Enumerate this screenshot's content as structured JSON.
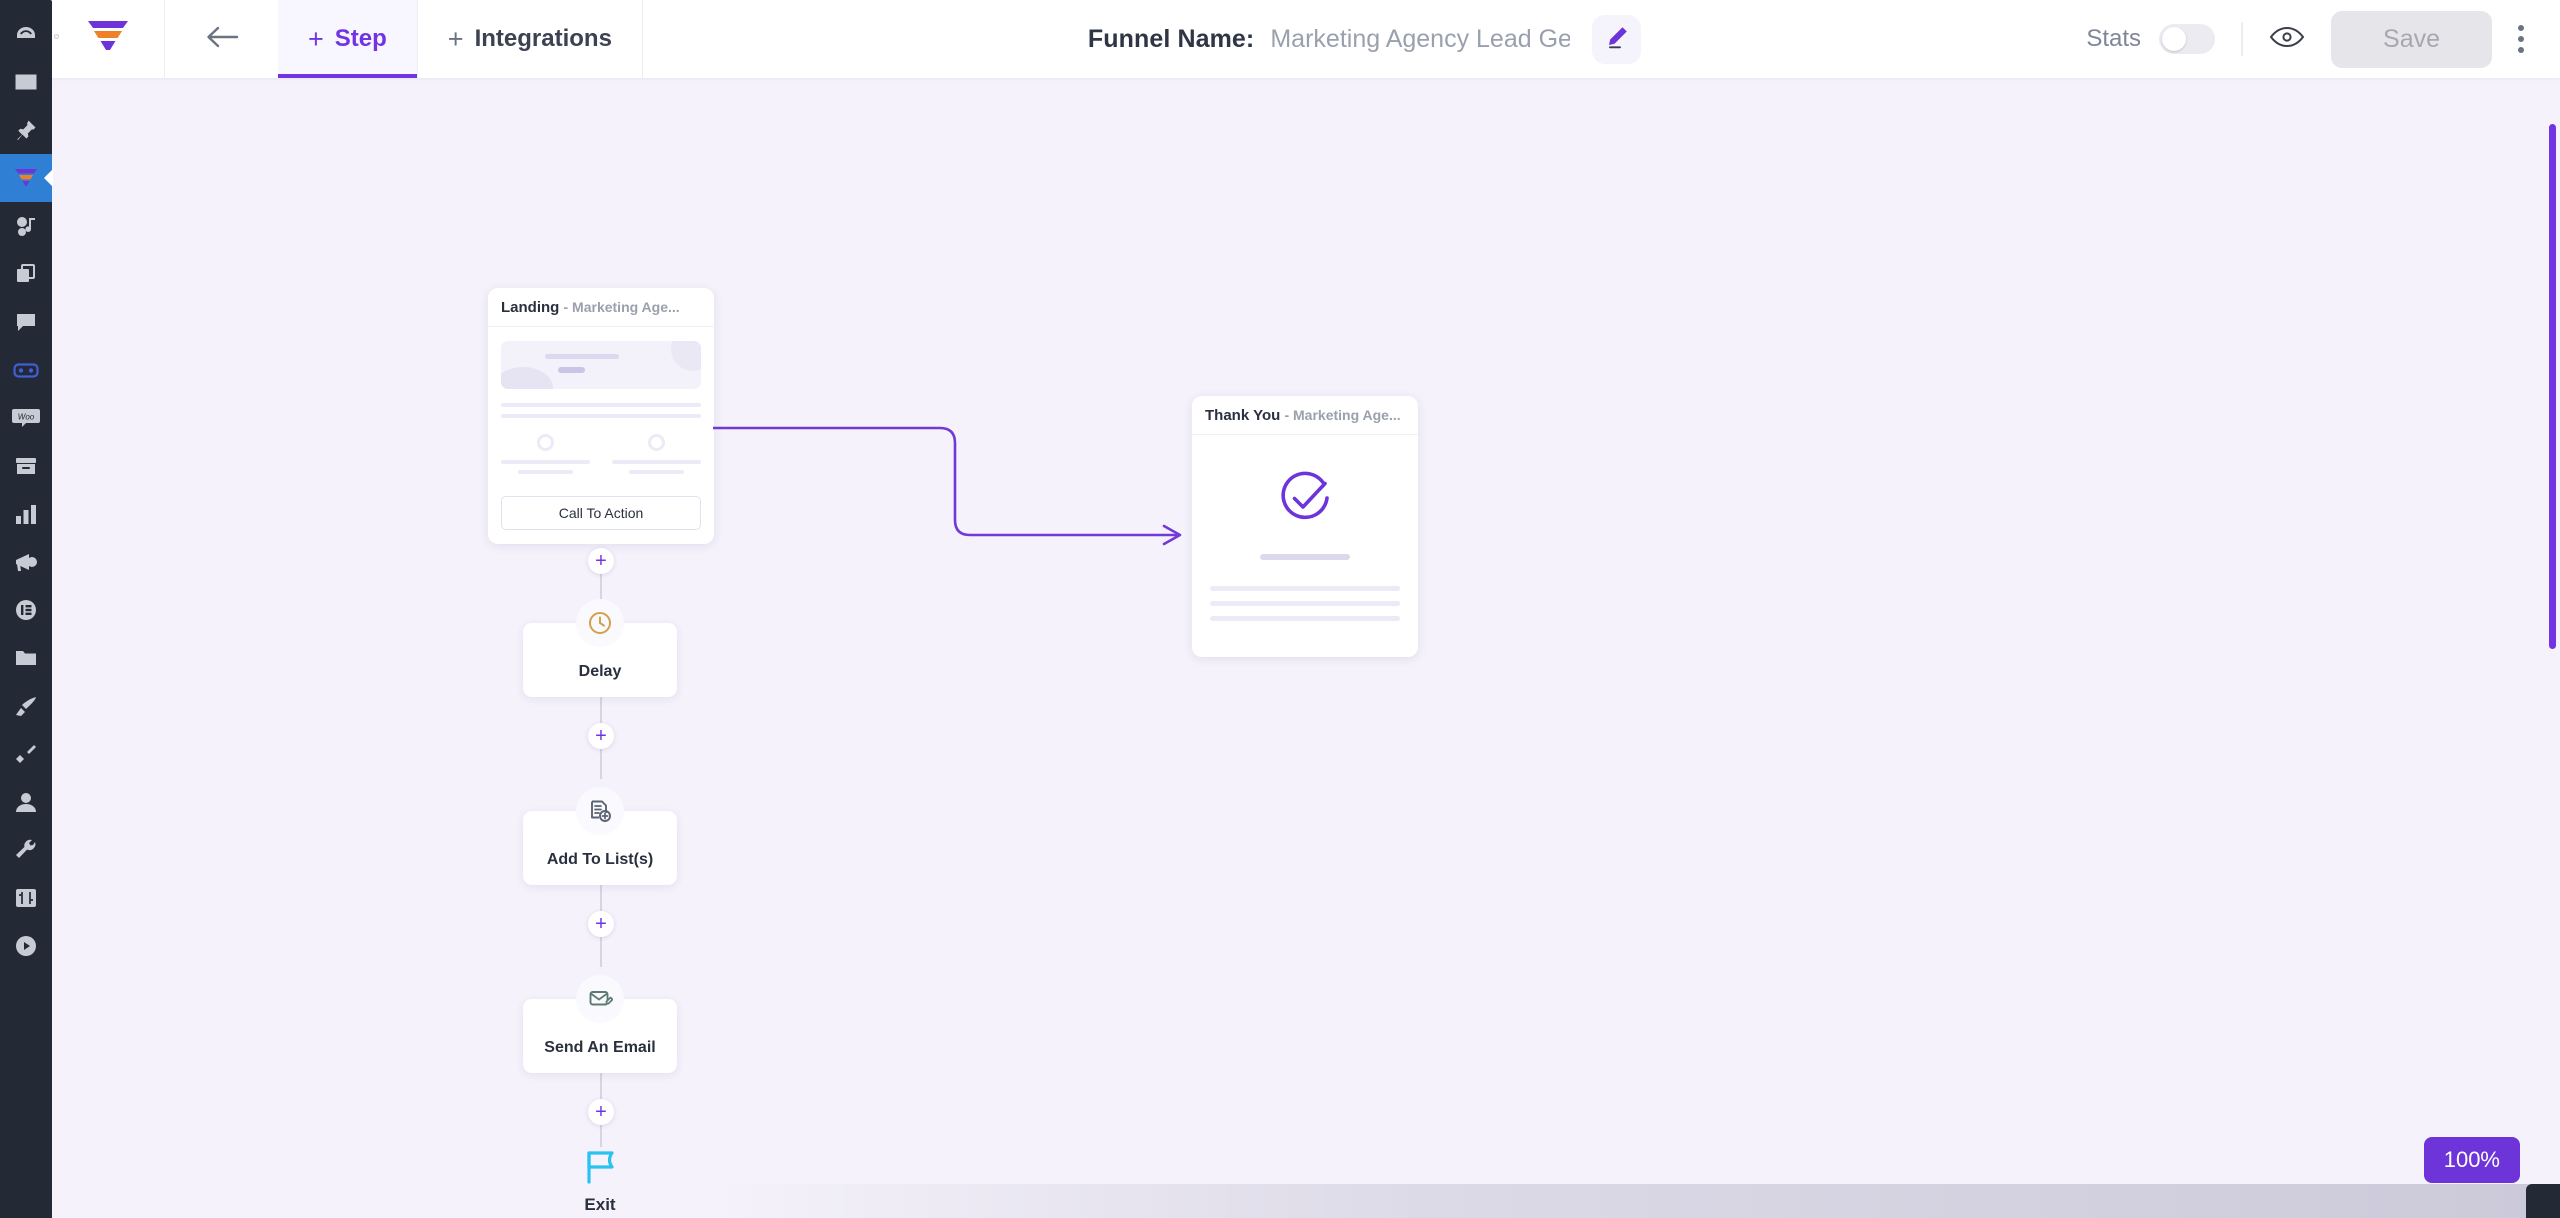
{
  "sidebar": {
    "items": [
      {
        "name": "dashboard",
        "icon": "gauge-icon",
        "active": false
      },
      {
        "name": "email",
        "icon": "envelope-icon",
        "active": false
      },
      {
        "name": "pin",
        "icon": "pin-icon",
        "active": false
      },
      {
        "name": "funnels",
        "icon": "funnel-icon",
        "active": true
      },
      {
        "name": "media",
        "icon": "media-icon",
        "active": false
      },
      {
        "name": "pages",
        "icon": "copy-pages-icon",
        "active": false
      },
      {
        "name": "chat",
        "icon": "chat-bubble-icon",
        "active": false
      },
      {
        "name": "vr",
        "icon": "vr-goggles-icon",
        "active": false
      },
      {
        "name": "woocommerce",
        "icon": "woo-icon",
        "active": false
      },
      {
        "name": "archive",
        "icon": "archive-box-icon",
        "active": false
      },
      {
        "name": "analytics",
        "icon": "bar-chart-icon",
        "active": false
      },
      {
        "name": "announcements",
        "icon": "megaphone-icon",
        "active": false
      },
      {
        "name": "elementor",
        "icon": "elementor-icon",
        "active": false
      },
      {
        "name": "files",
        "icon": "folder-icon",
        "active": false
      },
      {
        "name": "appearance",
        "icon": "paint-brush-icon",
        "active": false
      },
      {
        "name": "plugins",
        "icon": "plug-icon",
        "active": false
      },
      {
        "name": "users",
        "icon": "user-icon",
        "active": false
      },
      {
        "name": "tools",
        "icon": "wrench-icon",
        "active": false
      },
      {
        "name": "settings",
        "icon": "sliders-icon",
        "active": false
      },
      {
        "name": "player",
        "icon": "play-circle-icon",
        "active": false
      }
    ]
  },
  "topbar": {
    "brand_icon": "funnel-logo-icon",
    "back_icon": "arrow-left-icon",
    "tabs": [
      {
        "id": "step",
        "label": "Step",
        "prefix": "+",
        "selected": true
      },
      {
        "id": "integrations",
        "label": "Integrations",
        "prefix": "+",
        "selected": false
      }
    ],
    "funnel_name_label": "Funnel Name:",
    "funnel_name_value": "Marketing Agency Lead Gener...",
    "edit_icon": "pencil-icon",
    "stats_label": "Stats",
    "stats_enabled": false,
    "preview_icon": "eye-icon",
    "save_label": "Save",
    "more_icon": "kebab-menu-icon"
  },
  "canvas": {
    "zoom_level": "100%",
    "pages": [
      {
        "id": "landing",
        "title": "Landing",
        "subtitle": "- Marketing Age...",
        "cta_label": "Call To Action"
      },
      {
        "id": "thankyou",
        "title": "Thank You",
        "subtitle": "- Marketing Age...",
        "check_icon": "check-circle-icon"
      }
    ],
    "actions": [
      {
        "id": "delay",
        "label": "Delay",
        "icon": "clock-icon",
        "icon_color": "#d3a14a"
      },
      {
        "id": "add-to-lists",
        "label": "Add To List(s)",
        "icon": "list-add-icon",
        "icon_color": "#5a6372"
      },
      {
        "id": "send-an-email",
        "label": "Send An Email",
        "icon": "email-edit-icon",
        "icon_color": "#5d7a6e"
      }
    ],
    "exit": {
      "label": "Exit",
      "icon": "flag-icon",
      "icon_color": "#29c3f0"
    },
    "add_step_label": "+"
  },
  "colors": {
    "accent_purple": "#7234e3",
    "rail_bg": "#232a36",
    "rail_active": "#2f80d4",
    "canvas_bg": "#f5f2fb",
    "connector": "#7239d6"
  }
}
